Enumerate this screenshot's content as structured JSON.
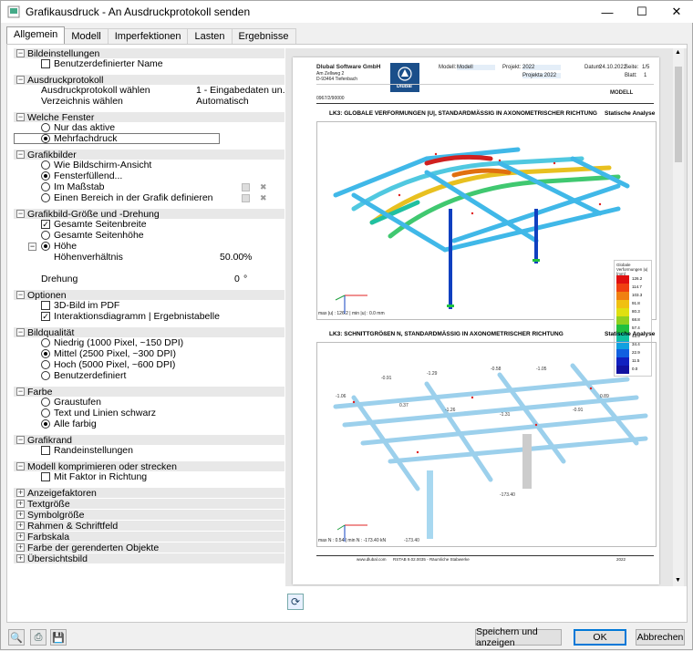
{
  "window": {
    "title": "Grafikausdruck - An Ausdruckprotokoll senden",
    "buttons": [
      "—",
      "☐",
      "✕"
    ]
  },
  "tabs": [
    "Allgemein",
    "Modell",
    "Imperfektionen",
    "Lasten",
    "Ergebnisse"
  ],
  "sections": {
    "bildeinstellungen": {
      "title": "Bildeinstellungen",
      "items": [
        "Benutzerdefinierter Name"
      ]
    },
    "ausdruckprotokoll": {
      "title": "Ausdruckprotokoll",
      "wählen": "Ausdruckprotokoll wählen",
      "wählen_val": "1 - Eingabedaten un...",
      "verz": "Verzeichnis wählen",
      "verz_val": "Automatisch"
    },
    "fenster": {
      "title": "Welche Fenster",
      "items": [
        "Nur das aktive",
        "Mehrfachdruck"
      ]
    },
    "grafikbilder": {
      "title": "Grafikbilder",
      "items": [
        "Wie Bildschirm-Ansicht",
        "Fensterfüllend...",
        "Im Maßstab",
        "Einen Bereich in der Grafik definieren"
      ]
    },
    "groesse": {
      "title": "Grafikbild-Größe und -Drehung",
      "items": [
        "Gesamte Seitenbreite",
        "Gesamte Seitenhöhe",
        "Höhe"
      ],
      "verh": "Höhenverhältnis",
      "verh_val": "50.00",
      "verh_unit": "%",
      "dreh": "Drehung",
      "dreh_val": "0",
      "dreh_unit": "°"
    },
    "optionen": {
      "title": "Optionen",
      "items": [
        "3D-Bild im PDF",
        "Interaktionsdiagramm | Ergebnistabelle"
      ]
    },
    "qualitaet": {
      "title": "Bildqualität",
      "items": [
        "Niedrig (1000 Pixel, ~150 DPI)",
        "Mittel (2500 Pixel, ~300 DPI)",
        "Hoch (5000 Pixel, ~600 DPI)",
        "Benutzerdefiniert"
      ]
    },
    "farbe": {
      "title": "Farbe",
      "items": [
        "Graustufen",
        "Text und Linien schwarz",
        "Alle farbig"
      ]
    },
    "grafikrand": {
      "title": "Grafikrand",
      "items": [
        "Randeinstellungen"
      ]
    },
    "komprimieren": {
      "title": "Modell komprimieren oder strecken",
      "items": [
        "Mit Faktor in Richtung"
      ]
    },
    "collapsed": [
      "Anzeigefaktoren",
      "Textgröße",
      "Symbolgröße",
      "Rahmen & Schriftfeld",
      "Farbskala",
      "Farbe der gerenderten Objekte",
      "Übersichtsbild"
    ]
  },
  "preview": {
    "company": "Dlubal Software GmbH",
    "addr1": "Am Zellweg 2",
    "addr2": "D-93464 Tiefenbach",
    "logo": "Dlubal",
    "modell_lbl": "Modell:",
    "modell": "Modell",
    "projekt_lbl": "Projekt:",
    "projekt": "2022",
    "projekt2": "Projekta 2022",
    "datum_lbl": "Datum:",
    "datum": "24.10.2022",
    "seite_lbl": "Seite:",
    "seite": "1/5",
    "blatt_lbl": "Blatt:",
    "blatt": "1",
    "doc": "0967/2/90000",
    "modell_head": "MODELL",
    "h1": "LK3: GLOBALE VERFORMUNGEN |U|, STANDARDMÄSSIG IN AXONOMETRISCHER RICHTUNG",
    "h1r": "Statische Analyse",
    "h2": "LK3: SCHNITTGRÖßEN N, STANDARDMÄSSIG IN AXONOMETRISCHER RICHTUNG",
    "h2r": "Statische Analyse",
    "foot1": "max |u| : 126.2 | min |u| : 0.0 mm",
    "foot2": "max N : 0.54 | min N : -173.40 kN",
    "legend_title": "Globale Verformungen |u| [mm]",
    "legend_vals": [
      "126.2",
      "114.7",
      "103.3",
      "91.8",
      "80.3",
      "68.8",
      "57.4",
      "45.9",
      "34.4",
      "22.9",
      "11.5",
      "0.0"
    ],
    "legend_colors": [
      "#e01010",
      "#f04010",
      "#f08010",
      "#f0c010",
      "#e0e010",
      "#90d020",
      "#20c040",
      "#10c0a0",
      "#10a0e0",
      "#1060e0",
      "#1020c0",
      "#1010a0"
    ],
    "bottom_url": "www.dlubal.com",
    "bottom_prog": "RSTAB 9.02.0035 - Räumliche Stabwerke",
    "bottom_year": "2022"
  },
  "buttons": {
    "save": "Speichern und anzeigen",
    "ok": "OK",
    "cancel": "Abbrechen"
  }
}
